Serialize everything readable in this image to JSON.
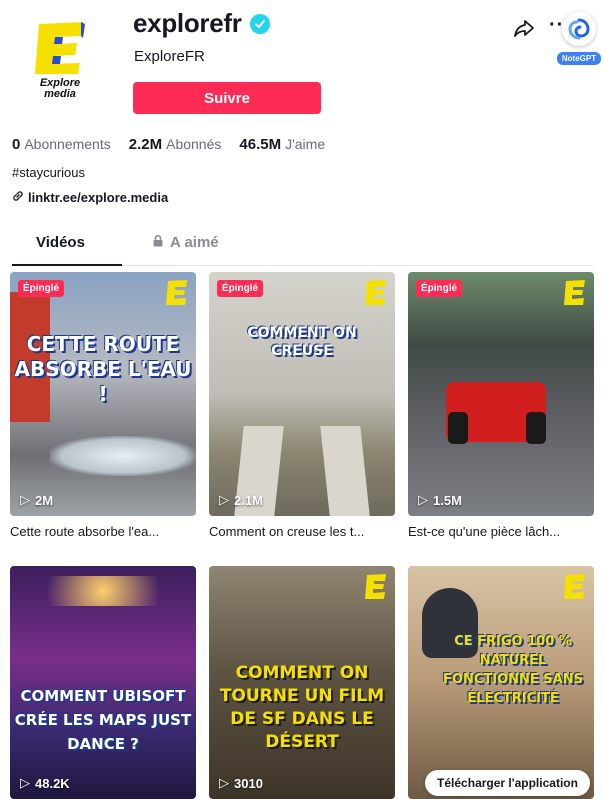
{
  "profile": {
    "username": "explorefr",
    "nickname": "ExploreFR",
    "avatar_text": "Explore\nmedia",
    "follow_label": "Suivre",
    "bio": "#staycurious",
    "link": "linktr.ee/explore.media"
  },
  "stats": [
    {
      "value": "0",
      "label": "Abonnements"
    },
    {
      "value": "2.2M",
      "label": "Abonnés"
    },
    {
      "value": "46.5M",
      "label": "J'aime"
    }
  ],
  "notegpt": {
    "label": "NoteGPT"
  },
  "tabs": {
    "videos": "Vidéos",
    "liked": "A aimé"
  },
  "videos": [
    {
      "pinned": "Épinglé",
      "views": "2M",
      "title": "Cette route absorbe l'ea...",
      "overlay": "CETTE ROUTE ABSORBE L'EAU !"
    },
    {
      "pinned": "Épinglé",
      "views": "2.1M",
      "title": "Comment on creuse les t...",
      "overlay": "COMMENT ON CREUSE"
    },
    {
      "pinned": "Épinglé",
      "views": "1.5M",
      "title": "Est-ce qu'une pièce lâch...",
      "overlay": ""
    },
    {
      "pinned": "",
      "views": "48.2K",
      "title": "",
      "overlay": "COMMENT UBISOFT CRÉE LES MAPS JUST DANCE ?"
    },
    {
      "pinned": "",
      "views": "3010",
      "title": "",
      "overlay": "COMMENT ON TOURNE UN FILM DE SF DANS LE DÉSERT"
    },
    {
      "pinned": "",
      "views": "",
      "title": "",
      "overlay": "CE FRIGO 100 % NATUREL FONCTIONNE SANS ÉLECTRICITÉ"
    }
  ],
  "download_app": "Télécharger l'application",
  "colors": {
    "accent": "#fe2c55",
    "verified": "#20d5ec",
    "brand_yellow": "#f5e000",
    "brand_blue": "#2a4bd7"
  }
}
